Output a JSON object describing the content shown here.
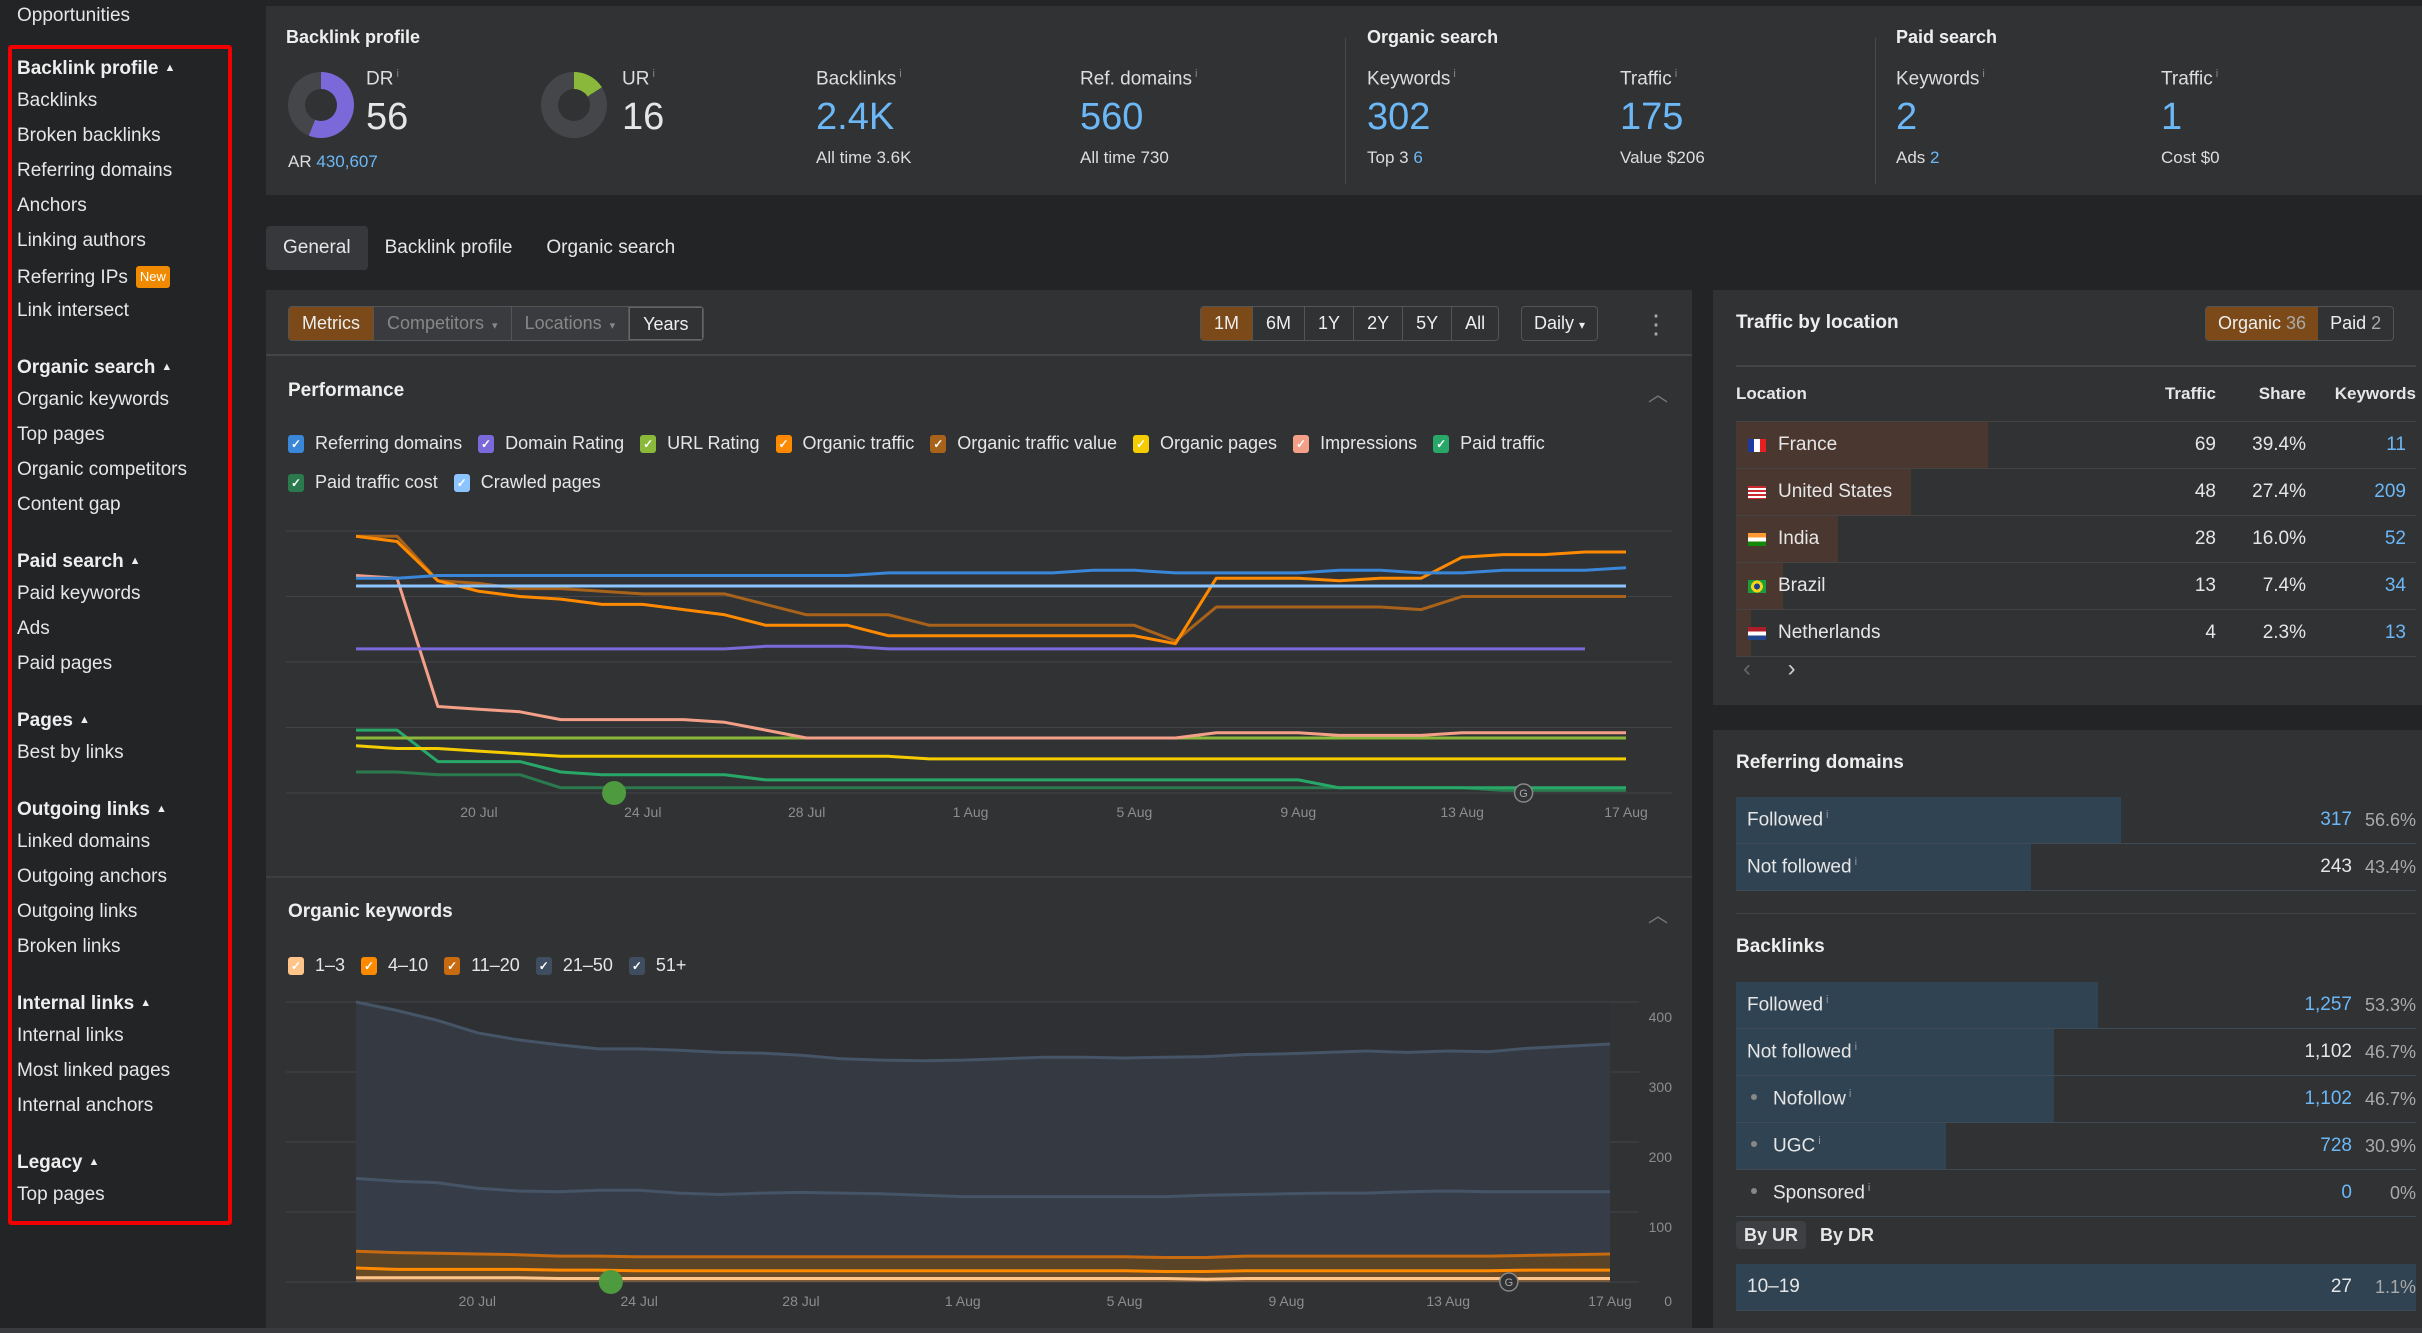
{
  "sidebar": {
    "top_item": "Opportunities",
    "groups": [
      {
        "title": "Backlink profile",
        "items": [
          "Backlinks",
          "Broken backlinks",
          "Referring domains",
          "Anchors",
          "Linking authors",
          "Referring IPs",
          "Link intersect"
        ],
        "badge_item": "Referring IPs",
        "badge": "New"
      },
      {
        "title": "Organic search",
        "items": [
          "Organic keywords",
          "Top pages",
          "Organic competitors",
          "Content gap"
        ]
      },
      {
        "title": "Paid search",
        "items": [
          "Paid keywords",
          "Ads",
          "Paid pages"
        ]
      },
      {
        "title": "Pages",
        "items": [
          "Best by links"
        ]
      },
      {
        "title": "Outgoing links",
        "items": [
          "Linked domains",
          "Outgoing anchors",
          "Outgoing links",
          "Broken links"
        ]
      },
      {
        "title": "Internal links",
        "items": [
          "Internal links",
          "Most linked pages",
          "Internal anchors"
        ]
      },
      {
        "title": "Legacy",
        "items": [
          "Top pages"
        ]
      }
    ]
  },
  "overview": {
    "backlink_profile": {
      "title": "Backlink profile",
      "dr": {
        "label": "DR",
        "value": "56",
        "fraction": 0.56,
        "sub_label": "AR",
        "sub_value": "430,607",
        "color": "#7b68d9"
      },
      "ur": {
        "label": "UR",
        "value": "16",
        "fraction": 0.16,
        "color": "#8ab83a"
      },
      "backlinks": {
        "label": "Backlinks",
        "value": "2.4K",
        "sub_label": "All time",
        "sub_value": "3.6K"
      },
      "ref_domains": {
        "label": "Ref. domains",
        "value": "560",
        "sub_label": "All time",
        "sub_value": "730"
      }
    },
    "organic_search": {
      "title": "Organic search",
      "keywords": {
        "label": "Keywords",
        "value": "302",
        "sub_label": "Top 3",
        "sub_value": "6"
      },
      "traffic": {
        "label": "Traffic",
        "value": "175",
        "sub_label": "Value",
        "sub_value": "$206"
      }
    },
    "paid_search": {
      "title": "Paid search",
      "keywords": {
        "label": "Keywords",
        "value": "2",
        "sub_label": "Ads",
        "sub_value": "2"
      },
      "traffic": {
        "label": "Traffic",
        "value": "1",
        "sub_label": "Cost",
        "sub_value": "$0"
      }
    },
    "info_glyph": "i"
  },
  "tabs": [
    {
      "label": "General",
      "active": true
    },
    {
      "label": "Backlink profile",
      "active": false
    },
    {
      "label": "Organic search",
      "active": false
    }
  ],
  "toolbar": {
    "modes": [
      {
        "label": "Metrics",
        "state": "on"
      },
      {
        "label": "Competitors",
        "state": "dim",
        "caret": true
      },
      {
        "label": "Locations",
        "state": "dim",
        "caret": true
      },
      {
        "label": "Years",
        "state": "normal"
      }
    ],
    "ranges": [
      {
        "label": "1M",
        "on": true
      },
      {
        "label": "6M"
      },
      {
        "label": "1Y"
      },
      {
        "label": "2Y"
      },
      {
        "label": "5Y"
      },
      {
        "label": "All"
      }
    ],
    "interval": "Daily",
    "caret": "▾",
    "more": "⋮"
  },
  "performance": {
    "title": "Performance",
    "legend": [
      {
        "label": "Referring domains",
        "color": "#3a86d8"
      },
      {
        "label": "Domain Rating",
        "color": "#7b68d9"
      },
      {
        "label": "URL Rating",
        "color": "#8ab83a"
      },
      {
        "label": "Organic traffic",
        "color": "#ff8a00"
      },
      {
        "label": "Organic traffic value",
        "color": "#a8621a"
      },
      {
        "label": "Organic pages",
        "color": "#f5cc00"
      },
      {
        "label": "Impressions",
        "color": "#f4a088"
      },
      {
        "label": "Paid traffic",
        "color": "#28a868"
      },
      {
        "label": "Paid traffic cost",
        "color": "#2a7a4e"
      },
      {
        "label": "Crawled pages",
        "color": "#8cc4ff"
      }
    ]
  },
  "organic_keywords": {
    "title": "Organic keywords",
    "legend": [
      {
        "label": "1–3",
        "color": "#ffc48a"
      },
      {
        "label": "4–10",
        "color": "#ff8a00"
      },
      {
        "label": "11–20",
        "color": "#c86a10"
      },
      {
        "label": "21–50",
        "color": "#3f4d60"
      },
      {
        "label": "51+",
        "color": "#3f4d60"
      }
    ]
  },
  "chart_data": [
    {
      "type": "line",
      "title": "Performance",
      "x": [
        "17 Jul",
        "18 Jul",
        "19 Jul",
        "20 Jul",
        "21 Jul",
        "22 Jul",
        "23 Jul",
        "24 Jul",
        "25 Jul",
        "26 Jul",
        "27 Jul",
        "28 Jul",
        "29 Jul",
        "30 Jul",
        "31 Jul",
        "1 Aug",
        "2 Aug",
        "3 Aug",
        "4 Aug",
        "5 Aug",
        "6 Aug",
        "7 Aug",
        "8 Aug",
        "9 Aug",
        "10 Aug",
        "11 Aug",
        "12 Aug",
        "13 Aug",
        "14 Aug",
        "15 Aug",
        "16 Aug",
        "17 Aug"
      ],
      "x_ticks": [
        "20 Jul",
        "24 Jul",
        "28 Jul",
        "1 Aug",
        "5 Aug",
        "9 Aug",
        "13 Aug",
        "17 Aug"
      ],
      "normalized": true,
      "ylim": [
        0,
        100
      ],
      "grid": true,
      "series": [
        {
          "name": "Referring domains",
          "color": "#3a86d8",
          "values": [
            82,
            82,
            83,
            83,
            83,
            83,
            83,
            83,
            83,
            83,
            83,
            83,
            83,
            84,
            84,
            84,
            84,
            84,
            85,
            85,
            84,
            84,
            84,
            84,
            85,
            85,
            84,
            84,
            85,
            85,
            85,
            86
          ]
        },
        {
          "name": "Crawled pages",
          "color": "#8cc4ff",
          "values": [
            79,
            79,
            79,
            79,
            79,
            79,
            79,
            79,
            79,
            79,
            79,
            79,
            79,
            79,
            79,
            79,
            79,
            79,
            79,
            79,
            79,
            79,
            79,
            79,
            79,
            79,
            79,
            79,
            79,
            79,
            79,
            79
          ]
        },
        {
          "name": "Organic traffic",
          "color": "#ff8a00",
          "values": [
            98,
            96,
            81,
            77,
            75,
            74,
            72,
            72,
            70,
            68,
            64,
            64,
            64,
            60,
            60,
            60,
            60,
            60,
            60,
            60,
            57,
            82,
            82,
            82,
            81,
            82,
            82,
            90,
            91,
            91,
            92,
            92
          ]
        },
        {
          "name": "Organic traffic value",
          "color": "#a8621a",
          "values": [
            98,
            98,
            81,
            80,
            78,
            78,
            77,
            76,
            76,
            76,
            72,
            68,
            68,
            68,
            64,
            64,
            64,
            64,
            64,
            64,
            58,
            71,
            71,
            71,
            71,
            71,
            70,
            75,
            75,
            75,
            75,
            75
          ]
        },
        {
          "name": "Domain Rating",
          "color": "#7b68d9",
          "values": [
            55,
            55,
            55,
            55,
            55,
            55,
            55,
            55,
            55,
            55,
            56,
            56,
            56,
            55,
            55,
            55,
            55,
            55,
            55,
            55,
            55,
            55,
            55,
            55,
            55,
            55,
            55,
            55,
            55,
            55,
            55,
            null
          ]
        },
        {
          "name": "Impressions",
          "color": "#f4a088",
          "values": [
            83,
            82,
            33,
            32,
            31,
            28,
            28,
            28,
            28,
            27,
            24,
            21,
            21,
            21,
            21,
            21,
            21,
            21,
            21,
            21,
            21,
            23,
            23,
            23,
            22,
            22,
            22,
            23,
            23,
            23,
            23,
            23
          ]
        },
        {
          "name": "URL Rating",
          "color": "#8ab83a",
          "values": [
            21,
            21,
            21,
            21,
            21,
            21,
            21,
            21,
            21,
            21,
            21,
            21,
            21,
            21,
            21,
            21,
            21,
            21,
            21,
            21,
            21,
            21,
            21,
            21,
            21,
            21,
            21,
            21,
            21,
            21,
            21,
            21
          ]
        },
        {
          "name": "Organic pages",
          "color": "#f5cc00",
          "values": [
            18,
            17,
            17,
            16,
            15,
            14,
            14,
            14,
            14,
            14,
            14,
            14,
            14,
            14,
            13,
            13,
            13,
            13,
            13,
            13,
            13,
            13,
            13,
            13,
            13,
            13,
            13,
            13,
            13,
            13,
            13,
            13
          ]
        },
        {
          "name": "Paid traffic",
          "color": "#28a868",
          "values": [
            24,
            24,
            12,
            12,
            12,
            8,
            7,
            7,
            7,
            7,
            5,
            5,
            5,
            5,
            5,
            5,
            5,
            5,
            5,
            5,
            5,
            5,
            5,
            5,
            2,
            2,
            2,
            2,
            2,
            2,
            2,
            2
          ]
        },
        {
          "name": "Paid traffic cost",
          "color": "#2a7a4e",
          "values": [
            8,
            8,
            7,
            7,
            7,
            2,
            2,
            2,
            2,
            2,
            2,
            2,
            2,
            2,
            2,
            2,
            2,
            2,
            2,
            2,
            2,
            2,
            2,
            2,
            2,
            2,
            2,
            2,
            1,
            1,
            1,
            1
          ]
        }
      ]
    },
    {
      "type": "area",
      "title": "Organic keywords",
      "stacked": true,
      "x": [
        "17 Jul",
        "18 Jul",
        "19 Jul",
        "20 Jul",
        "21 Jul",
        "22 Jul",
        "23 Jul",
        "24 Jul",
        "25 Jul",
        "26 Jul",
        "27 Jul",
        "28 Jul",
        "29 Jul",
        "30 Jul",
        "31 Jul",
        "1 Aug",
        "2 Aug",
        "3 Aug",
        "4 Aug",
        "5 Aug",
        "6 Aug",
        "7 Aug",
        "8 Aug",
        "9 Aug",
        "10 Aug",
        "11 Aug",
        "12 Aug",
        "13 Aug",
        "14 Aug",
        "15 Aug",
        "16 Aug",
        "17 Aug"
      ],
      "x_ticks": [
        "20 Jul",
        "24 Jul",
        "28 Jul",
        "1 Aug",
        "5 Aug",
        "9 Aug",
        "13 Aug",
        "17 Aug"
      ],
      "y_ticks": [
        0,
        100,
        200,
        300,
        400
      ],
      "ylim": [
        0,
        400
      ],
      "grid": true,
      "series": [
        {
          "name": "1–3",
          "color": "#ffc48a",
          "values": [
            6,
            6,
            6,
            6,
            6,
            5,
            5,
            5,
            5,
            5,
            5,
            5,
            5,
            5,
            5,
            5,
            5,
            5,
            5,
            5,
            5,
            4,
            5,
            5,
            5,
            5,
            5,
            5,
            5,
            5,
            5,
            5
          ]
        },
        {
          "name": "4–10",
          "color": "#ff8a00",
          "values": [
            14,
            12,
            12,
            12,
            12,
            12,
            12,
            11,
            11,
            11,
            11,
            11,
            11,
            11,
            11,
            11,
            11,
            11,
            11,
            11,
            10,
            11,
            11,
            11,
            11,
            11,
            11,
            11,
            11,
            12,
            12,
            12
          ]
        },
        {
          "name": "11–20",
          "color": "#c86a10",
          "values": [
            24,
            24,
            23,
            22,
            21,
            20,
            20,
            20,
            20,
            20,
            20,
            20,
            20,
            20,
            20,
            20,
            20,
            20,
            20,
            20,
            20,
            20,
            21,
            21,
            21,
            21,
            21,
            21,
            21,
            21,
            22,
            23
          ]
        },
        {
          "name": "21–50",
          "color": "#3f4d60",
          "values": [
            104,
            102,
            101,
            94,
            91,
            92,
            94,
            95,
            91,
            89,
            91,
            92,
            91,
            90,
            88,
            86,
            86,
            86,
            86,
            86,
            87,
            89,
            88,
            89,
            90,
            90,
            92,
            93,
            92,
            91,
            90,
            89
          ]
        },
        {
          "name": "51+",
          "color": "#3f4d60",
          "values": [
            252,
            244,
            232,
            222,
            216,
            210,
            202,
            202,
            204,
            203,
            200,
            196,
            192,
            191,
            192,
            195,
            197,
            199,
            199,
            198,
            199,
            198,
            200,
            200,
            201,
            203,
            199,
            200,
            200,
            205,
            208,
            211
          ]
        }
      ]
    }
  ],
  "traffic_by_location": {
    "title": "Traffic by location",
    "toggle": [
      {
        "label": "Organic",
        "count": "36",
        "on": true
      },
      {
        "label": "Paid",
        "count": "2",
        "on": false
      }
    ],
    "columns": [
      "Location",
      "Traffic",
      "Share",
      "Keywords"
    ],
    "rows": [
      {
        "location": "France",
        "flag": "fr",
        "traffic": "69",
        "share": "39.4%",
        "share_fraction": 0.394,
        "keywords": "11"
      },
      {
        "location": "United States",
        "flag": "us",
        "traffic": "48",
        "share": "27.4%",
        "share_fraction": 0.274,
        "keywords": "209"
      },
      {
        "location": "India",
        "flag": "in",
        "traffic": "28",
        "share": "16.0%",
        "share_fraction": 0.16,
        "keywords": "52"
      },
      {
        "location": "Brazil",
        "flag": "br",
        "traffic": "13",
        "share": "7.4%",
        "share_fraction": 0.074,
        "keywords": "34"
      },
      {
        "location": "Netherlands",
        "flag": "nl",
        "traffic": "4",
        "share": "2.3%",
        "share_fraction": 0.023,
        "keywords": "13"
      }
    ],
    "prev": "‹",
    "next": "›"
  },
  "referring_domains": {
    "title": "Referring domains",
    "rows": [
      {
        "label": "Followed",
        "value": "317",
        "pct": "56.6%",
        "fraction": 0.566,
        "link": true
      },
      {
        "label": "Not followed",
        "value": "243",
        "pct": "43.4%",
        "fraction": 0.434,
        "link": false
      }
    ]
  },
  "backlinks_breakdown": {
    "title": "Backlinks",
    "rows": [
      {
        "label": "Followed",
        "value": "1,257",
        "pct": "53.3%",
        "fraction": 0.533,
        "link": true,
        "sub": false
      },
      {
        "label": "Not followed",
        "value": "1,102",
        "pct": "46.7%",
        "fraction": 0.467,
        "link": false,
        "sub": false
      },
      {
        "label": "Nofollow",
        "value": "1,102",
        "pct": "46.7%",
        "fraction": 0.467,
        "link": true,
        "sub": true
      },
      {
        "label": "UGC",
        "value": "728",
        "pct": "30.9%",
        "fraction": 0.309,
        "link": true,
        "sub": true
      },
      {
        "label": "Sponsored",
        "value": "0",
        "pct": "0%",
        "fraction": 0,
        "link": true,
        "sub": true
      }
    ],
    "subtabs": [
      {
        "label": "By UR",
        "on": true
      },
      {
        "label": "By DR",
        "on": false
      }
    ],
    "range_rows": [
      {
        "label": "10–19",
        "value": "27",
        "pct": "1.1%",
        "fraction": 1.0
      }
    ]
  }
}
